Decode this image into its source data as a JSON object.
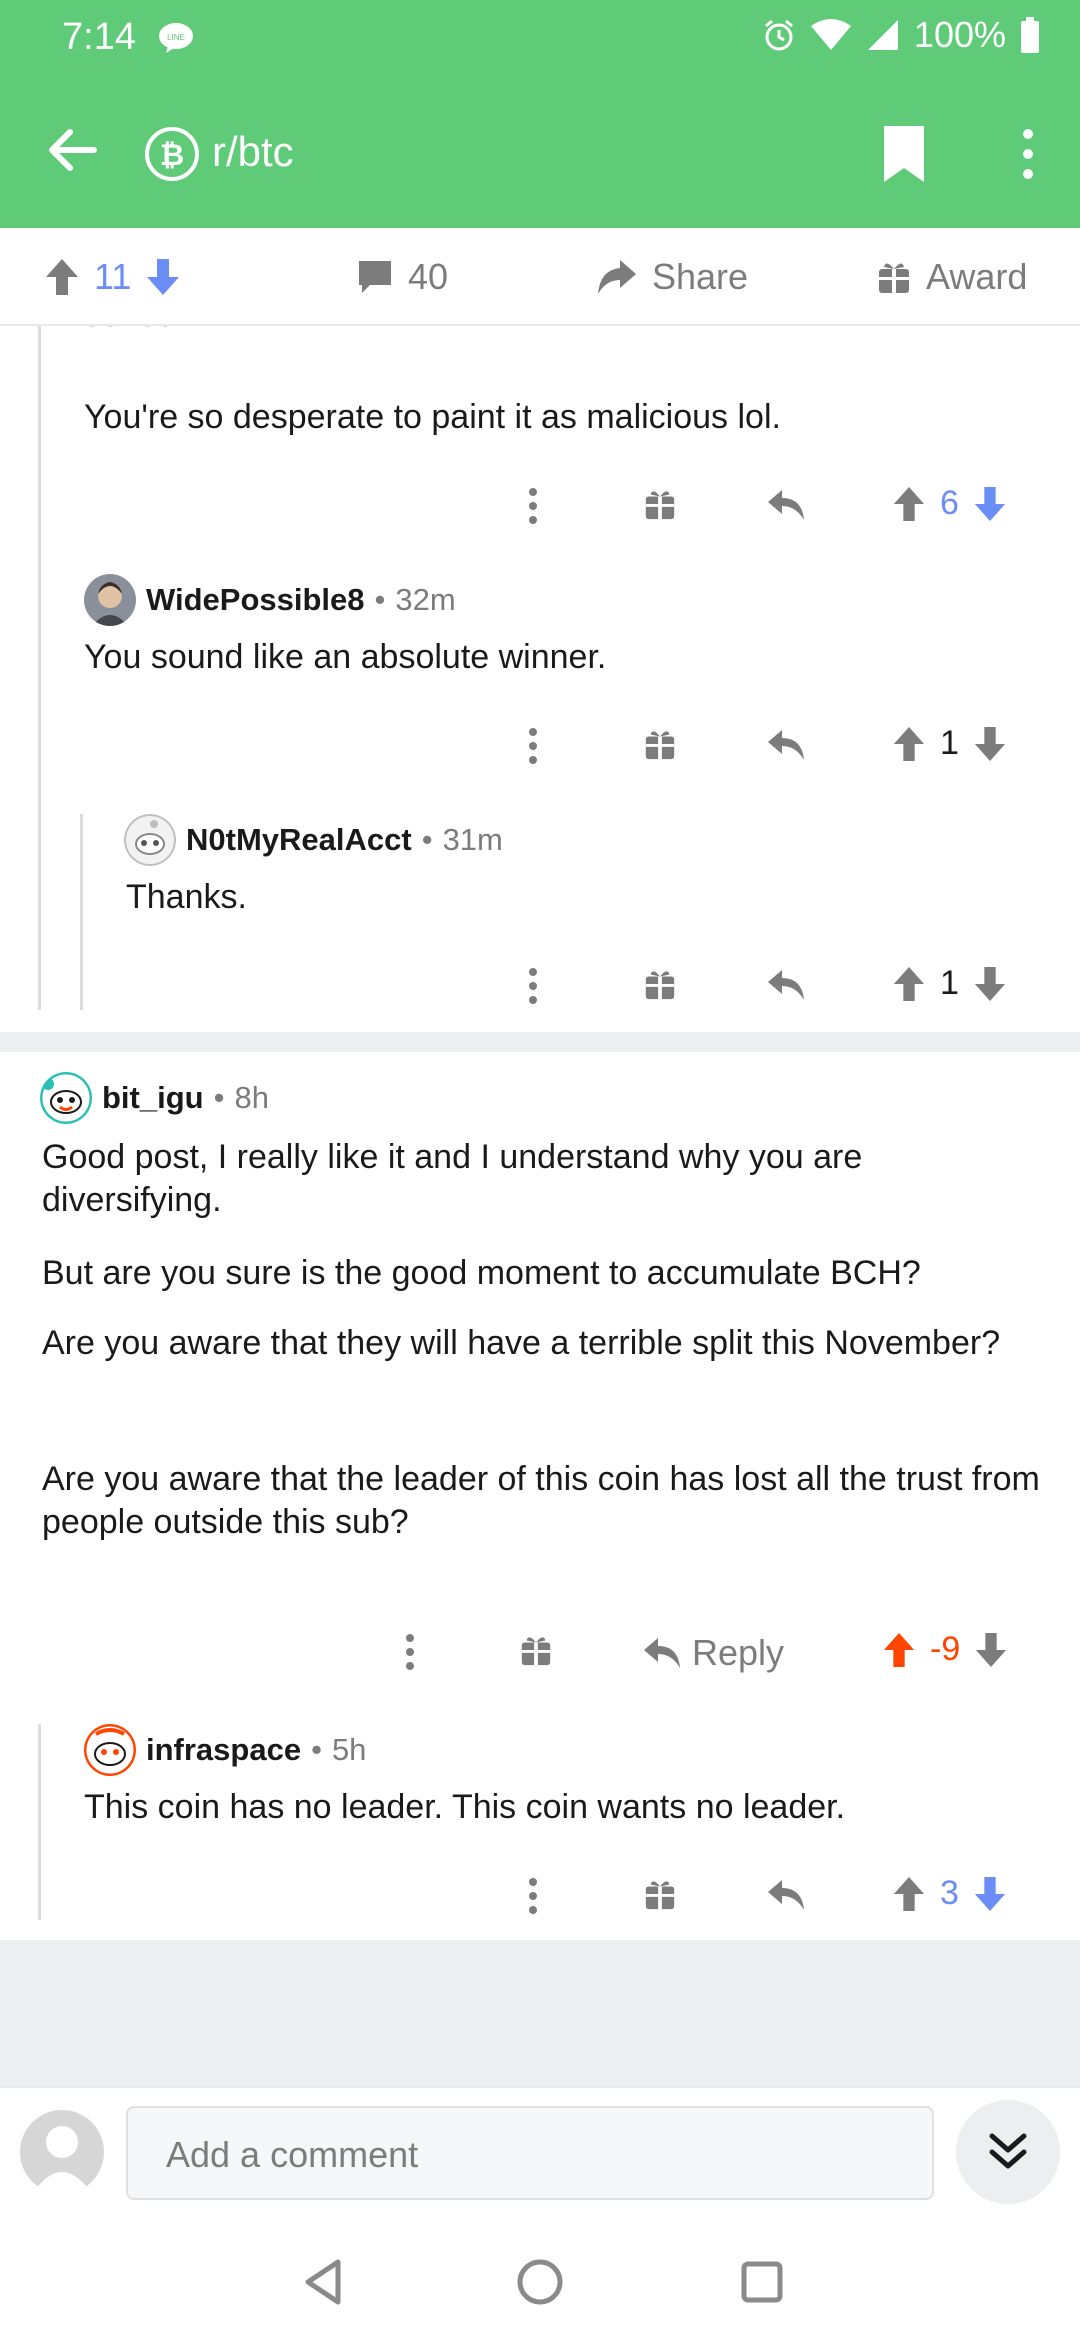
{
  "status": {
    "time": "7:14",
    "notification": "LINE",
    "battery": "100%"
  },
  "appbar": {
    "subreddit": "r/btc"
  },
  "postbar": {
    "upvotes": "11",
    "comments": "40",
    "share": "Share",
    "award": "Award"
  },
  "colors": {
    "brand_green": "#5fcb78",
    "upvote_active": "#ff4500",
    "downvote_active": "#6a8ef6",
    "score_blue": "#6a8ef6",
    "score_red": "#ff4500"
  },
  "thread": {
    "cutoff_text": "sense.",
    "top_comment": {
      "text": "You're so desperate to paint it as malicious lol.",
      "score": "6"
    },
    "c1": {
      "author": "WidePossible8",
      "age": "32m",
      "text": "You sound like an absolute winner.",
      "score": "1"
    },
    "c2": {
      "author": "N0tMyRealAcct",
      "age": "31m",
      "text": "Thanks.",
      "score": "1"
    }
  },
  "thread2": {
    "main": {
      "author": "bit_igu",
      "age": "8h",
      "paragraphs": [
        "Good post, I really like it and I understand why you are diversifying.",
        "But are you sure is the good moment to accumulate BCH?",
        "Are you aware that they will have a terrible split this November?",
        "Are you aware that the leader of this coin has lost all the trust from people outside this sub?"
      ],
      "reply_label": "Reply",
      "score": "-9"
    },
    "reply": {
      "author": "infraspace",
      "age": "5h",
      "text": "This coin has no leader. This coin wants no leader.",
      "score": "3"
    }
  },
  "compose": {
    "placeholder": "Add a comment"
  },
  "separator": "•"
}
